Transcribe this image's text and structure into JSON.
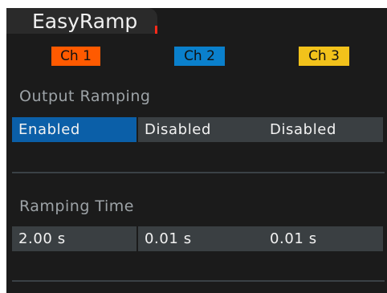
{
  "header": {
    "title": "EasyRamp"
  },
  "channels": [
    {
      "label": "Ch 1",
      "color": "#ff5a00"
    },
    {
      "label": "Ch 2",
      "color": "#0a80cc"
    },
    {
      "label": "Ch 3",
      "color": "#f2c21b"
    }
  ],
  "output_ramping": {
    "label": "Output Ramping",
    "values": [
      "Enabled",
      "Disabled",
      "Disabled"
    ],
    "selected_index": 0
  },
  "ramping_time": {
    "label": "Ramping Time",
    "values": [
      "2.00 s",
      "0.01 s",
      "0.01 s"
    ]
  },
  "colors": {
    "background": "#1b1b1b",
    "cell": "#3a3f42",
    "selected": "#0b5fa8",
    "label": "#9da3a7",
    "text": "#f2f2f2"
  }
}
